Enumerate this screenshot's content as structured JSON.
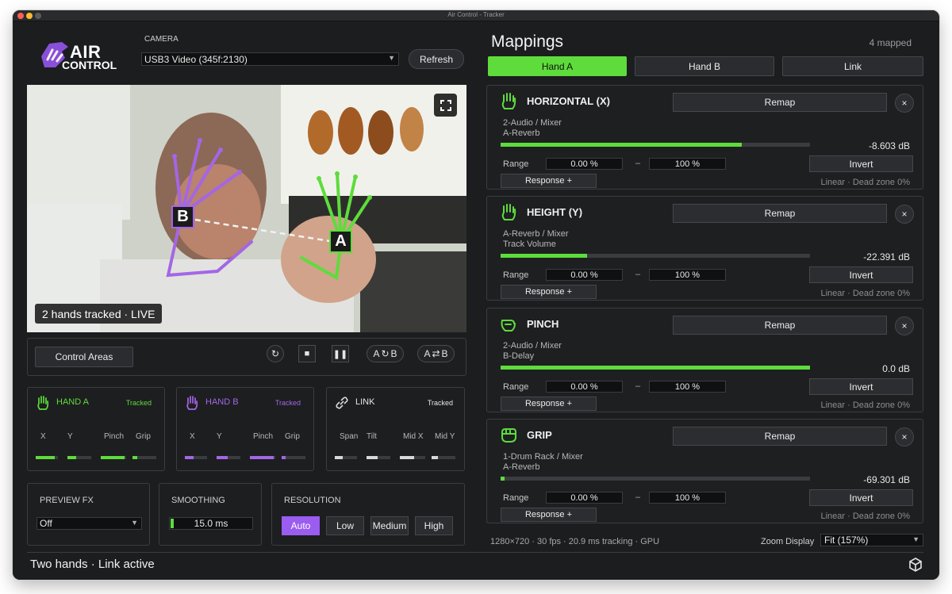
{
  "window": {
    "title": "Air Control - Tracker"
  },
  "brand": {
    "line1": "AIR",
    "line2": "CONTROL",
    "color": "#8a4fd8"
  },
  "camera": {
    "label": "CAMERA",
    "device": "USB3 Video (345f:2130)",
    "refresh": "Refresh"
  },
  "preview": {
    "status": "2 hands tracked · LIVE",
    "marker_a": "A",
    "marker_b": "B"
  },
  "controls": {
    "control_areas": "Control Areas",
    "link_mode_a": "A",
    "link_mode_b": "B",
    "swap_a": "A",
    "swap_b": "B"
  },
  "hand_cards": [
    {
      "name": "HAND A",
      "status": "Tracked",
      "color": "#5edc3c",
      "labels": [
        "X",
        "Y",
        "Pinch",
        "Grip"
      ],
      "levels": [
        0.85,
        0.35,
        0.95,
        0.2
      ]
    },
    {
      "name": "HAND B",
      "status": "Tracked",
      "color": "#a466e6",
      "labels": [
        "X",
        "Y",
        "Pinch",
        "Grip"
      ],
      "levels": [
        0.4,
        0.45,
        0.95,
        0.15
      ]
    },
    {
      "name": "LINK",
      "status": "Tracked",
      "color": "#d8d8d8",
      "labels": [
        "Span",
        "Tilt",
        "Mid X",
        "Mid Y"
      ],
      "levels": [
        0.35,
        0.45,
        0.55,
        0.25
      ]
    }
  ],
  "settings": {
    "preview_fx": {
      "label": "PREVIEW FX",
      "value": "Off"
    },
    "smoothing": {
      "label": "SMOOTHING",
      "value": "15.0 ms"
    },
    "resolution": {
      "label": "RESOLUTION",
      "options": [
        "Auto",
        "Low",
        "Medium",
        "High"
      ],
      "selected": "Auto"
    }
  },
  "status_bar": {
    "text": "Two hands · Link active"
  },
  "mappings": {
    "title": "Mappings",
    "count": "4 mapped",
    "tabs": [
      "Hand A",
      "Hand B",
      "Link"
    ],
    "active_tab": "Hand A",
    "accent": "#5edc3c",
    "range_label": "Range",
    "remap_label": "Remap",
    "close_label": "×",
    "invert_label": "Invert",
    "response_label": "Response +",
    "items": [
      {
        "title": "HORIZONTAL (X)",
        "icon": "open-hand-icon",
        "path1": "2-Audio / Mixer",
        "path2": "A-Reverb",
        "level": 0.78,
        "value": "-8.603 dB",
        "min": "0.00 %",
        "max": "100 %",
        "mode": "Linear · Dead zone 0%"
      },
      {
        "title": "HEIGHT (Y)",
        "icon": "open-hand-icon",
        "path1": "A-Reverb / Mixer",
        "path2": "Track Volume",
        "level": 0.28,
        "value": "-22.391 dB",
        "min": "0.00 %",
        "max": "100 %",
        "mode": "Linear · Dead zone 0%"
      },
      {
        "title": "PINCH",
        "icon": "pinch-hand-icon",
        "path1": "2-Audio / Mixer",
        "path2": "B-Delay",
        "level": 1.0,
        "value": "0.0 dB",
        "min": "0.00 %",
        "max": "100 %",
        "mode": "Linear · Dead zone 0%"
      },
      {
        "title": "GRIP",
        "icon": "fist-icon",
        "path1": "1-Drum Rack / Mixer",
        "path2": "A-Reverb",
        "level": 0.01,
        "value": "-69.301 dB",
        "min": "0.00 %",
        "max": "100 %",
        "mode": "Linear · Dead zone 0%"
      }
    ]
  },
  "footer": {
    "info": "1280×720 · 30 fps · 20.9 ms tracking · GPU",
    "zoom_label": "Zoom Display",
    "zoom_value": "Fit (157%)"
  }
}
